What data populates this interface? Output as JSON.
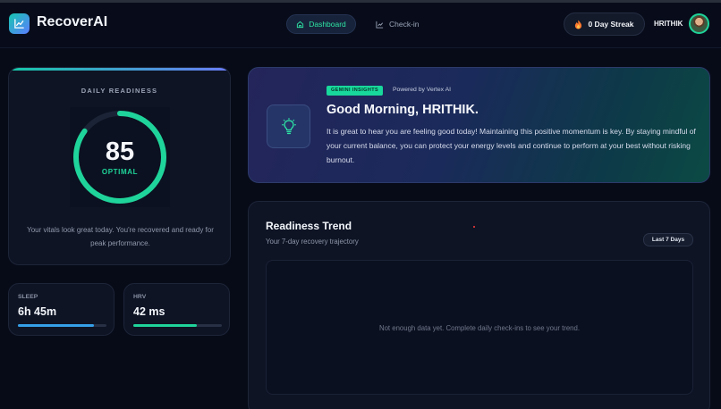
{
  "app": {
    "name": "RecoverAI"
  },
  "nav": {
    "dashboard_label": "Dashboard",
    "checkin_label": "Check-in"
  },
  "streak": {
    "label": "0 Day Streak"
  },
  "user": {
    "name": "HRITHIK"
  },
  "readiness": {
    "title": "DAILY READINESS",
    "score": "85",
    "score_value": 85,
    "status": "OPTIMAL",
    "description": "Your vitals look great today. You're recovered and ready for peak performance."
  },
  "metrics": [
    {
      "label": "SLEEP",
      "value": "6h 45m",
      "fill_fraction": 0.86,
      "color": "#35a0e8"
    },
    {
      "label": "HRV",
      "value": "42 ms",
      "fill_fraction": 0.72,
      "color": "#1fd49a"
    }
  ],
  "insights": {
    "badge": "GEMINI INSIGHTS",
    "powered_by": "Powered by Vertex AI",
    "greeting": "Good Morning, HRITHIK.",
    "message": "It is great to hear you are feeling good today! Maintaining this positive momentum is key. By staying mindful of your current balance, you can protect your energy levels and continue to perform at your best without risking burnout."
  },
  "trend": {
    "title": "Readiness Trend",
    "subtitle": "Your 7-day recovery trajectory",
    "range_label": "Last 7 Days",
    "empty_message": "Not enough data yet. Complete daily check-ins to see your trend."
  },
  "colors": {
    "accent_green": "#1fd49a",
    "background": "#070b18",
    "card": "#0e1424"
  },
  "icons": {
    "logo": "chart-line-icon",
    "dashboard": "home-icon",
    "checkin": "chart-line-icon",
    "streak": "flame-icon",
    "insight": "lightbulb-icon"
  }
}
